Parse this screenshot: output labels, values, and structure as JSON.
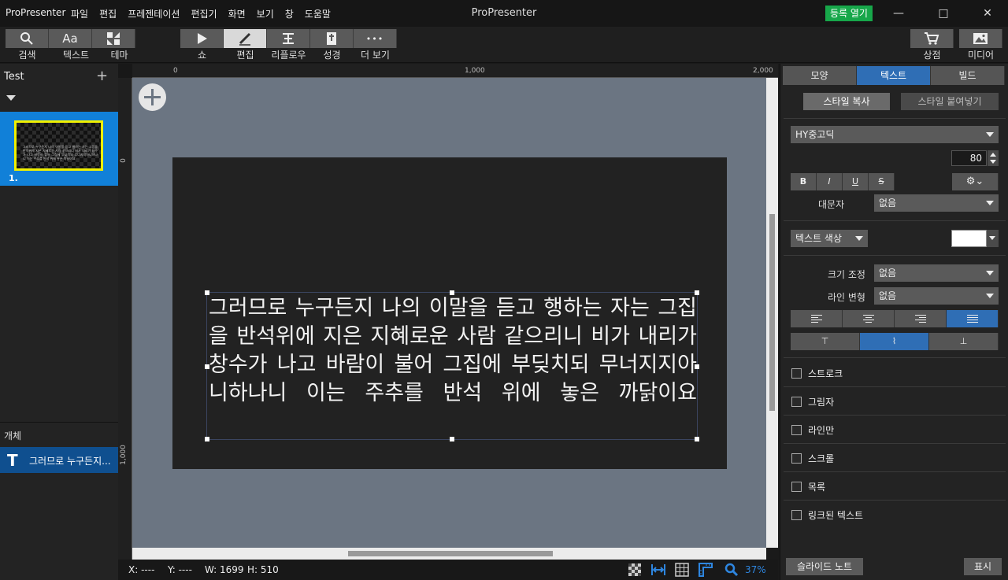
{
  "app": {
    "name": "ProPresenter",
    "window_title": "ProPresenter",
    "register_label": "등록 열기",
    "menu": [
      "파일",
      "편집",
      "프레젠테이션",
      "편집기",
      "화면",
      "보기",
      "창",
      "도움말"
    ]
  },
  "toolbar": {
    "left": [
      {
        "label": "검색",
        "icon": "search-icon"
      },
      {
        "label": "텍스트",
        "icon": "text-icon",
        "glyph": "Aa"
      },
      {
        "label": "테마",
        "icon": "theme-icon"
      }
    ],
    "center": [
      {
        "label": "쇼",
        "icon": "play-icon",
        "active": false
      },
      {
        "label": "편집",
        "icon": "edit-icon",
        "active": true
      },
      {
        "label": "리플로우",
        "icon": "reflow-icon",
        "active": false
      },
      {
        "label": "성경",
        "icon": "bible-icon",
        "active": false
      },
      {
        "label": "더 보기",
        "icon": "more-icon",
        "glyph": "•••",
        "active": false
      }
    ],
    "right": [
      {
        "label": "상점",
        "icon": "cart-icon"
      },
      {
        "label": "미디어",
        "icon": "media-icon"
      }
    ]
  },
  "left_panel": {
    "library_name": "Test",
    "slide_number": "1.",
    "objects_title": "개체",
    "object_item_label": "그러므로 누구든지...",
    "object_item_glyph": "T"
  },
  "editor": {
    "slide_text": "그러므로 누구든지 나의 이말을 듣고 행하는 자는 그집을 반석위에 지은 지혜로운 사람 같으리니 비가 내리가 창수가 나고 바람이 불어 그집에 부딪치되 무너지지아니하나니 이는 주추를 반석 위에 놓은 까닭이요",
    "ruler_h": [
      "0",
      "1,000",
      "2,000"
    ],
    "ruler_v": [
      "0",
      "1,000"
    ]
  },
  "status": {
    "x": "X: ----",
    "y": "Y: ----",
    "w": "W: 1699",
    "h": "H: 510",
    "zoom": "37%"
  },
  "right_panel": {
    "tabs": [
      {
        "label": "모양",
        "active": false
      },
      {
        "label": "텍스트",
        "active": true
      },
      {
        "label": "빌드",
        "active": false
      }
    ],
    "copy_style": "스타일 복사",
    "paste_style": "스타일 붙여넣기",
    "font": "HY중고딕",
    "font_size": "80",
    "format_buttons": [
      "B",
      "I",
      "U",
      "S"
    ],
    "capitalization_label": "대문자",
    "capitalization_value": "없음",
    "text_color_label": "텍스트 색상",
    "text_color": "#ffffff",
    "scale_label": "크기 조정",
    "scale_value": "없음",
    "line_transform_label": "라인 변형",
    "line_transform_value": "없음",
    "options": [
      "스트로크",
      "그림자",
      "라인만",
      "스크롤",
      "목록",
      "링크된 텍스트"
    ],
    "slide_notes": "슬라이드 노트",
    "show": "표시"
  },
  "colors": {
    "accent": "#2f6eb5",
    "selection": "#1180d8",
    "register_green": "#17a74a",
    "thumb_border": "#f0f000"
  }
}
